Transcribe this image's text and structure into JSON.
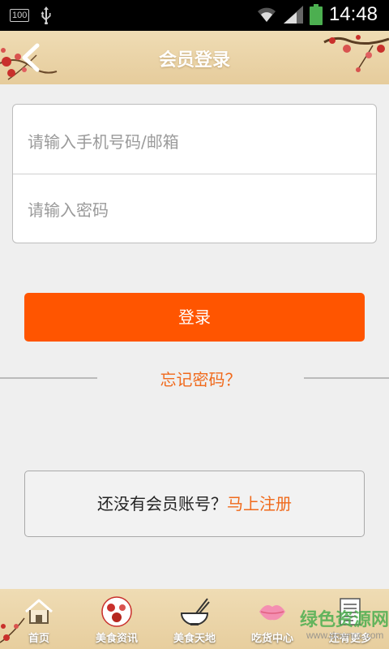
{
  "status_bar": {
    "battery_text": "100",
    "time": "14:48"
  },
  "header": {
    "title": "会员登录"
  },
  "form": {
    "phone_placeholder": "请输入手机号码/邮箱",
    "password_placeholder": "请输入密码"
  },
  "login_button": "登录",
  "forgot_password": "忘记密码？",
  "register": {
    "prompt": "还没有会员账号？",
    "link": "马上注册"
  },
  "bottom_nav": {
    "items": [
      {
        "label": "首页",
        "icon": "home-icon"
      },
      {
        "label": "美食资讯",
        "icon": "food-news-icon"
      },
      {
        "label": "美食天地",
        "icon": "bowl-chopsticks-icon"
      },
      {
        "label": "吃货中心",
        "icon": "lips-icon"
      },
      {
        "label": "还有更多",
        "icon": "document-icon"
      }
    ]
  },
  "watermark": {
    "text": "绿色资源网",
    "url": "www.downcc.com"
  },
  "colors": {
    "accent": "#ff5500",
    "link": "#f06a1c",
    "header_bg": "#e9d3a6"
  }
}
